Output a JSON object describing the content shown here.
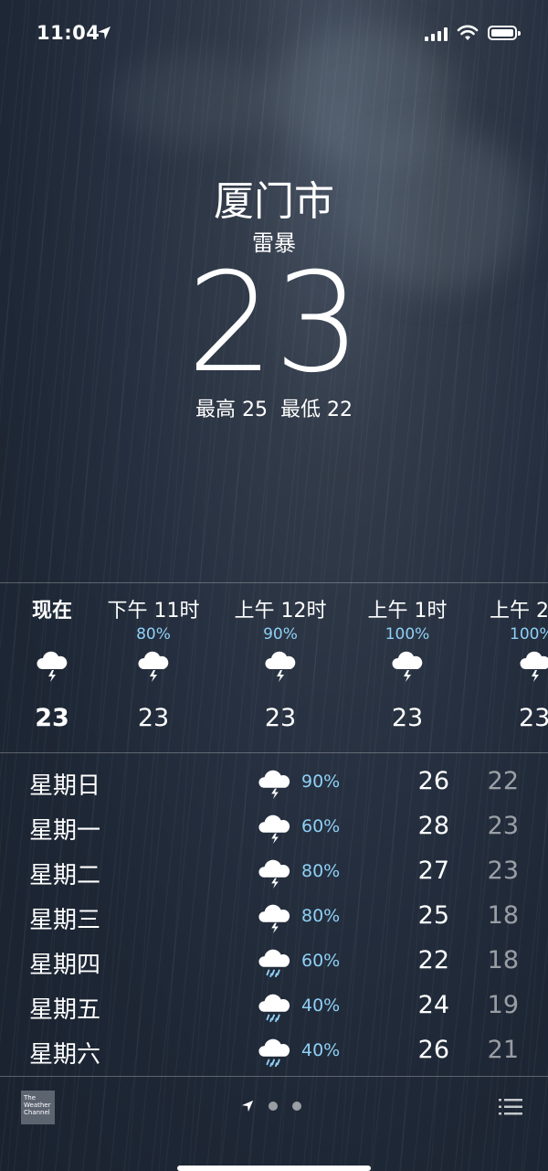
{
  "status_bar": {
    "time": "11:04"
  },
  "location": {
    "city": "厦门市",
    "condition": "雷暴",
    "temperature": "23",
    "high": "最高 25",
    "low": "最低 22"
  },
  "hourly": [
    {
      "label": "现在",
      "pct": "",
      "icon": "thunderstorm-icon",
      "temp": "23"
    },
    {
      "label": "下午 11时",
      "pct": "80%",
      "icon": "thunderstorm-icon",
      "temp": "23"
    },
    {
      "label": "上午 12时",
      "pct": "90%",
      "icon": "thunderstorm-icon",
      "temp": "23"
    },
    {
      "label": "上午 1时",
      "pct": "100%",
      "icon": "thunderstorm-icon",
      "temp": "23"
    },
    {
      "label": "上午 2",
      "pct": "100%",
      "icon": "thunderstorm-icon",
      "temp": "23"
    }
  ],
  "daily": [
    {
      "day": "星期日",
      "icon": "thunderstorm-icon",
      "pct": "90%",
      "hi": "26",
      "lo": "22"
    },
    {
      "day": "星期一",
      "icon": "thunderstorm-icon",
      "pct": "60%",
      "hi": "28",
      "lo": "23"
    },
    {
      "day": "星期二",
      "icon": "thunderstorm-icon",
      "pct": "80%",
      "hi": "27",
      "lo": "23"
    },
    {
      "day": "星期三",
      "icon": "thunderstorm-icon",
      "pct": "80%",
      "hi": "25",
      "lo": "18"
    },
    {
      "day": "星期四",
      "icon": "rain-icon",
      "pct": "60%",
      "hi": "22",
      "lo": "18"
    },
    {
      "day": "星期五",
      "icon": "rain-icon",
      "pct": "40%",
      "hi": "24",
      "lo": "19"
    },
    {
      "day": "星期六",
      "icon": "rain-icon",
      "pct": "40%",
      "hi": "26",
      "lo": "21"
    }
  ],
  "footer": {
    "logo_text": "The Weather Channel",
    "page_indicator": [
      "location-arrow-icon",
      "dot",
      "dot"
    ],
    "list_icon": "list-icon"
  },
  "colors": {
    "accent_pct": "#8fd0f5",
    "background": "#263040"
  }
}
